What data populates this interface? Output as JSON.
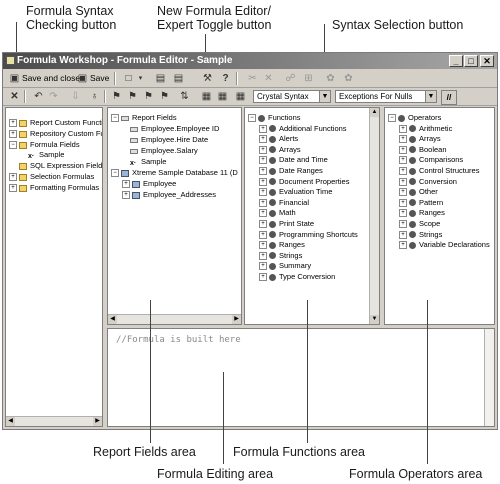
{
  "callouts": {
    "syntax_check": "Formula Syntax\nChecking button",
    "editor_toggle": "New Formula Editor/\nExpert Toggle button",
    "syntax_selection": "Syntax Selection button",
    "report_fields_area": "Report Fields area",
    "functions_area": "Formula Functions area",
    "editing_area": "Formula Editing area",
    "operators_area": "Formula Operators area"
  },
  "window": {
    "title": "Formula Workshop - Formula Editor - Sample"
  },
  "toolbar1": {
    "save_close": "Save and close",
    "save": "Save"
  },
  "toolbar2": {
    "syntax_value": "Crystal Syntax",
    "nulls_value": "Exceptions For Nulls",
    "comment_btn": "//"
  },
  "workshop_tree": [
    "Report Custom Functio",
    "Repository Custom Fur",
    "Formula Fields",
    "Sample",
    "SQL Expression Fields",
    "Selection Formulas",
    "Formatting Formulas"
  ],
  "fields_tree": [
    "Report Fields",
    "Employee.Employee ID",
    "Employee.Hire Date",
    "Employee.Salary",
    "Sample",
    "Xtreme Sample Database 11 (D",
    "Employee",
    "Employee_Addresses"
  ],
  "functions_tree": [
    "Functions",
    "Additional Functions",
    "Alerts",
    "Arrays",
    "Date and Time",
    "Date Ranges",
    "Document Properties",
    "Evaluation Time",
    "Financial",
    "Math",
    "Print State",
    "Programming Shortcuts",
    "Ranges",
    "Strings",
    "Summary",
    "Type Conversion"
  ],
  "operators_tree": [
    "Operators",
    "Arithmetic",
    "Arrays",
    "Boolean",
    "Comparisons",
    "Control Structures",
    "Conversion",
    "Other",
    "Pattern",
    "Ranges",
    "Scope",
    "Strings",
    "Variable Declarations"
  ],
  "editor": {
    "text": "//Formula is built here"
  }
}
